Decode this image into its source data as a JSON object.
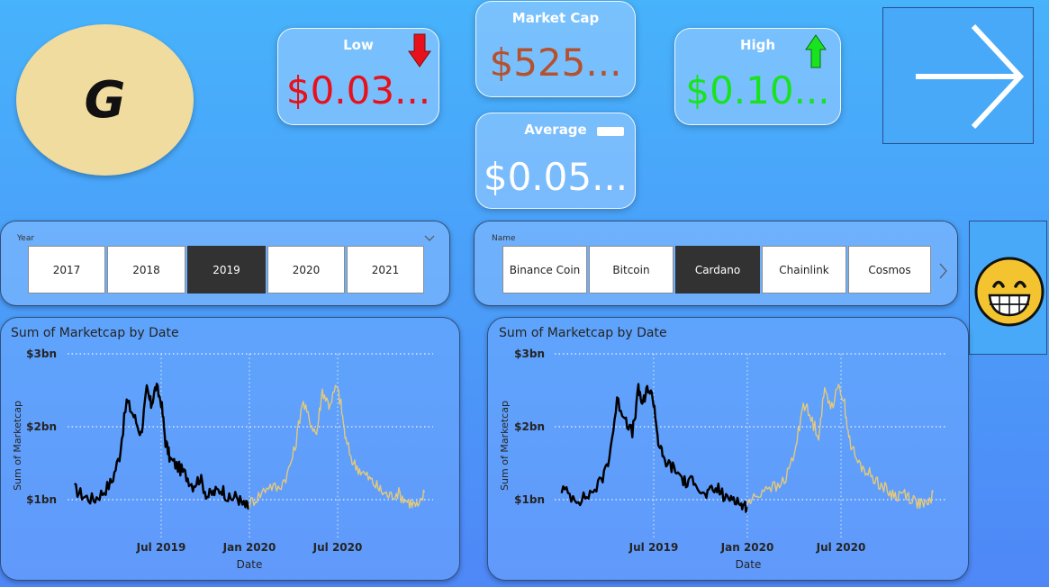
{
  "logo": {
    "letter": "G"
  },
  "kpis": {
    "low": {
      "title": "Low",
      "value": "$0.03...",
      "color": "#e8101a",
      "indicator": "red-down-arrow-icon"
    },
    "market_cap": {
      "title": "Market Cap",
      "value": "$525...",
      "color": "#b5522e"
    },
    "average": {
      "title": "Average",
      "value": "$0.05...",
      "color": "#ffffff",
      "indicator": "white-bar-icon"
    },
    "high": {
      "title": "High",
      "value": "$0.10...",
      "color": "#19e31e",
      "indicator": "green-up-arrow-icon"
    }
  },
  "nav": {
    "next_icon": "arrow-right-icon"
  },
  "year_slicer": {
    "label": "Year",
    "options": [
      "2017",
      "2018",
      "2019",
      "2020",
      "2021"
    ],
    "selected": "2019"
  },
  "name_slicer": {
    "label": "Name",
    "options": [
      "Binance Coin",
      "Bitcoin",
      "Cardano",
      "Chainlink",
      "Cosmos"
    ],
    "selected": "Cardano"
  },
  "emoji": {
    "icon": "grinning-face-icon"
  },
  "colors": {
    "selected_series": "#000000",
    "other_series": "#e3c97a"
  },
  "charts": [
    {
      "title": "Sum of Marketcap by Date",
      "ylabel": "Sum of Marketcap",
      "xlabel": "Date",
      "yticks": [
        "$3bn",
        "$2bn",
        "$1bn"
      ],
      "xticks": [
        "Jul 2019",
        "Jan 2020",
        "Jul 2020"
      ]
    },
    {
      "title": "Sum of Marketcap by Date",
      "ylabel": "Sum of Marketcap",
      "xlabel": "Date",
      "yticks": [
        "$3bn",
        "$2bn",
        "$1bn"
      ],
      "xticks": [
        "Jul 2019",
        "Jan 2020",
        "Jul 2020"
      ]
    }
  ],
  "chart_data": [
    {
      "type": "line",
      "title": "Sum of Marketcap by Date",
      "xlabel": "Date",
      "ylabel": "Sum of Marketcap",
      "yunit": "bn USD",
      "ylim": [
        0.8,
        3.0
      ],
      "xlim": [
        "2019-01-01",
        "2020-12-31"
      ],
      "series": [
        {
          "name": "2019",
          "x": [
            "2019-01-01",
            "2019-01-20",
            "2019-02-10",
            "2019-03-01",
            "2019-03-20",
            "2019-04-05",
            "2019-04-20",
            "2019-05-05",
            "2019-05-20",
            "2019-06-01",
            "2019-06-10",
            "2019-06-20",
            "2019-07-01",
            "2019-07-10",
            "2019-07-20",
            "2019-08-05",
            "2019-08-20",
            "2019-09-05",
            "2019-09-20",
            "2019-10-05",
            "2019-10-20",
            "2019-11-05",
            "2019-11-20",
            "2019-12-05",
            "2019-12-20",
            "2019-12-31"
          ],
          "values": [
            1.15,
            1.05,
            1.0,
            1.1,
            1.25,
            1.6,
            2.35,
            2.15,
            1.9,
            2.5,
            2.3,
            2.55,
            2.35,
            1.8,
            1.55,
            1.45,
            1.35,
            1.2,
            1.3,
            1.05,
            1.1,
            1.15,
            1.0,
            1.05,
            0.92,
            0.9
          ]
        },
        {
          "name": "2020",
          "x": [
            "2020-01-01",
            "2020-01-20",
            "2020-02-10",
            "2020-03-01",
            "2020-03-20",
            "2020-04-05",
            "2020-04-20",
            "2020-05-05",
            "2020-05-20",
            "2020-06-01",
            "2020-06-15",
            "2020-07-01",
            "2020-07-10",
            "2020-07-20",
            "2020-08-05",
            "2020-08-20",
            "2020-09-05",
            "2020-09-20",
            "2020-10-05",
            "2020-10-20",
            "2020-11-05",
            "2020-11-20",
            "2020-12-05",
            "2020-12-20",
            "2020-12-31"
          ],
          "values": [
            0.95,
            1.05,
            1.2,
            1.15,
            1.35,
            1.7,
            2.35,
            2.1,
            1.9,
            2.5,
            2.3,
            2.55,
            2.3,
            1.8,
            1.5,
            1.4,
            1.3,
            1.2,
            1.1,
            1.05,
            1.1,
            1.0,
            0.95,
            0.9,
            1.1
          ]
        }
      ]
    },
    {
      "type": "line",
      "title": "Sum of Marketcap by Date",
      "xlabel": "Date",
      "ylabel": "Sum of Marketcap",
      "yunit": "bn USD",
      "ylim": [
        0.8,
        3.0
      ],
      "xlim": [
        "2019-01-01",
        "2020-12-31"
      ],
      "series": [
        {
          "name": "2019",
          "x": [
            "2019-01-01",
            "2019-01-20",
            "2019-02-10",
            "2019-03-01",
            "2019-03-20",
            "2019-04-05",
            "2019-04-20",
            "2019-05-05",
            "2019-05-20",
            "2019-06-01",
            "2019-06-10",
            "2019-06-20",
            "2019-07-01",
            "2019-07-10",
            "2019-07-20",
            "2019-08-05",
            "2019-08-20",
            "2019-09-05",
            "2019-09-20",
            "2019-10-05",
            "2019-10-20",
            "2019-11-05",
            "2019-11-20",
            "2019-12-05",
            "2019-12-20",
            "2019-12-31"
          ],
          "values": [
            1.15,
            1.05,
            1.0,
            1.1,
            1.25,
            1.6,
            2.35,
            2.15,
            1.9,
            2.5,
            2.3,
            2.55,
            2.35,
            1.8,
            1.55,
            1.45,
            1.35,
            1.2,
            1.3,
            1.05,
            1.1,
            1.15,
            1.0,
            1.05,
            0.92,
            0.9
          ]
        },
        {
          "name": "2020",
          "x": [
            "2020-01-01",
            "2020-01-20",
            "2020-02-10",
            "2020-03-01",
            "2020-03-20",
            "2020-04-05",
            "2020-04-20",
            "2020-05-05",
            "2020-05-20",
            "2020-06-01",
            "2020-06-15",
            "2020-07-01",
            "2020-07-10",
            "2020-07-20",
            "2020-08-05",
            "2020-08-20",
            "2020-09-05",
            "2020-09-20",
            "2020-10-05",
            "2020-10-20",
            "2020-11-05",
            "2020-11-20",
            "2020-12-05",
            "2020-12-20",
            "2020-12-31"
          ],
          "values": [
            0.95,
            1.05,
            1.2,
            1.15,
            1.35,
            1.7,
            2.35,
            2.1,
            1.9,
            2.5,
            2.3,
            2.55,
            2.3,
            1.8,
            1.5,
            1.4,
            1.3,
            1.2,
            1.1,
            1.05,
            1.1,
            1.0,
            0.95,
            0.9,
            1.1
          ]
        }
      ]
    }
  ]
}
